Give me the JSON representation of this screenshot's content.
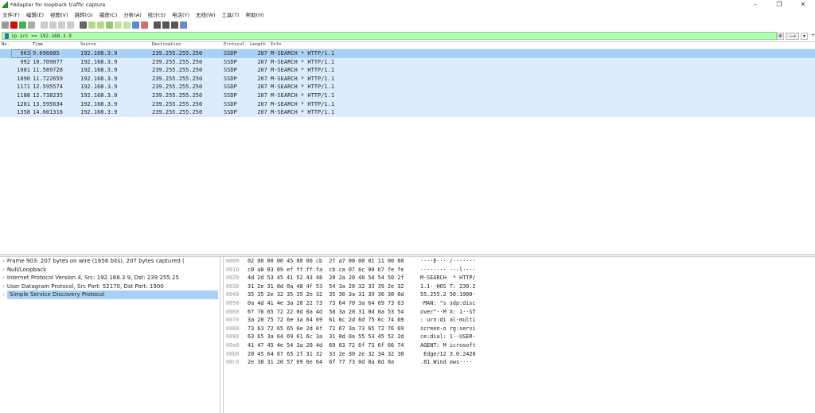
{
  "window": {
    "title": "*Adapter for loopback traffic capture",
    "minimize": "–",
    "maximize": "❐",
    "close": "✕"
  },
  "menu": [
    "文件(F)",
    "编辑(E)",
    "视图(V)",
    "跳转(G)",
    "捕获(C)",
    "分析(A)",
    "统计(S)",
    "电话(Y)",
    "无线(W)",
    "工具(T)",
    "帮助(H)"
  ],
  "toolbar": [
    {
      "icon": "shark-fin-start-icon",
      "color": "#9a9a9a"
    },
    {
      "icon": "stop-icon",
      "color": "#d01010"
    },
    {
      "icon": "restart-icon",
      "color": "#4caf50"
    },
    {
      "icon": "options-gear-icon",
      "color": "#aaaaaa"
    },
    {
      "icon": "open-file-icon",
      "color": "#cccccc"
    },
    {
      "icon": "save-icon",
      "color": "#cccccc"
    },
    {
      "icon": "close-file-icon",
      "color": "#cccccc"
    },
    {
      "icon": "reload-icon",
      "color": "#cccccc"
    },
    {
      "icon": "find-icon",
      "color": "#666666"
    },
    {
      "icon": "back-icon",
      "color": "#b8d88a"
    },
    {
      "icon": "forward-icon",
      "color": "#b8d88a"
    },
    {
      "icon": "go-to-packet-icon",
      "color": "#9bc27a"
    },
    {
      "icon": "first-packet-icon",
      "color": "#c8e0a0"
    },
    {
      "icon": "last-packet-icon",
      "color": "#c8e0a0"
    },
    {
      "icon": "autoscroll-icon",
      "color": "#5a8ad0"
    },
    {
      "icon": "colorize-icon",
      "color": "#d07070"
    },
    {
      "icon": "zoom-in-icon",
      "color": "#555555"
    },
    {
      "icon": "zoom-out-icon",
      "color": "#555555"
    },
    {
      "icon": "zoom-reset-icon",
      "color": "#555555"
    },
    {
      "icon": "resize-columns-icon",
      "color": "#6a8ac8"
    }
  ],
  "filter": {
    "value": "ip.src == 192.168.3.9",
    "clear": "⊗",
    "apply": "⟶",
    "dropdown": "▾",
    "add": "+"
  },
  "columns": {
    "no": "No.",
    "time": "Time",
    "source": "Source",
    "destination": "Destination",
    "protocol": "Protocol",
    "length": "Length",
    "info": "Info"
  },
  "packets": [
    {
      "no": "903",
      "time": "9.696685",
      "source": "192.168.3.9",
      "destination": "239.255.255.250",
      "protocol": "SSDP",
      "length": "207",
      "info": "M-SEARCH * HTTP/1.1"
    },
    {
      "no": "992",
      "time": "10.709077",
      "source": "192.168.3.9",
      "destination": "239.255.255.250",
      "protocol": "SSDP",
      "length": "207",
      "info": "M-SEARCH * HTTP/1.1"
    },
    {
      "no": "1081",
      "time": "11.589728",
      "source": "192.168.3.9",
      "destination": "239.255.255.250",
      "protocol": "SSDP",
      "length": "207",
      "info": "M-SEARCH * HTTP/1.1"
    },
    {
      "no": "1090",
      "time": "11.722659",
      "source": "192.168.3.9",
      "destination": "239.255.255.250",
      "protocol": "SSDP",
      "length": "207",
      "info": "M-SEARCH * HTTP/1.1"
    },
    {
      "no": "1171",
      "time": "12.595574",
      "source": "192.168.3.9",
      "destination": "239.255.255.250",
      "protocol": "SSDP",
      "length": "207",
      "info": "M-SEARCH * HTTP/1.1"
    },
    {
      "no": "1188",
      "time": "12.738235",
      "source": "192.168.3.9",
      "destination": "239.255.255.250",
      "protocol": "SSDP",
      "length": "207",
      "info": "M-SEARCH * HTTP/1.1"
    },
    {
      "no": "1261",
      "time": "13.595634",
      "source": "192.168.3.9",
      "destination": "239.255.255.250",
      "protocol": "SSDP",
      "length": "207",
      "info": "M-SEARCH * HTTP/1.1"
    },
    {
      "no": "1358",
      "time": "14.601316",
      "source": "192.168.3.9",
      "destination": "239.255.255.250",
      "protocol": "SSDP",
      "length": "207",
      "info": "M-SEARCH * HTTP/1.1"
    }
  ],
  "details": [
    {
      "text": "Frame 903: 207 bytes on wire (1656 bits), 207 bytes captured (",
      "expanded": false
    },
    {
      "text": "Null/Loopback",
      "expanded": false
    },
    {
      "text": "Internet Protocol Version 4, Src: 192.168.3.9, Dst: 239.255.25",
      "expanded": false
    },
    {
      "text": "User Datagram Protocol, Src Port: 52170, Dst Port: 1900",
      "expanded": false
    },
    {
      "text": "Simple Service Discovery Protocol",
      "expanded": false,
      "selected": true
    }
  ],
  "hex": [
    {
      "off": "0000",
      "bytes": "02 00 00 00 45 00 00 cb  2f a7 00 00 01 11 00 00",
      "ascii": "····E··· /·······"
    },
    {
      "off": "0010",
      "bytes": "c0 a8 03 09 ef ff ff fa  cb ca 07 6c 00 b7 fe fe",
      "ascii": "········ ···l····"
    },
    {
      "off": "0020",
      "bytes": "4d 2d 53 45 41 52 43 48  20 2a 20 48 54 54 50 2f",
      "ascii": "M-SEARCH  * HTTP/"
    },
    {
      "off": "0030",
      "bytes": "31 2e 31 0d 0a 48 4f 53  54 3a 20 32 33 39 2e 32",
      "ascii": "1.1··HOS T: 239.2"
    },
    {
      "off": "0040",
      "bytes": "35 35 2e 32 35 35 2e 32  35 30 3a 31 39 30 30 0d",
      "ascii": "55.255.2 50:1900·"
    },
    {
      "off": "0050",
      "bytes": "0a 4d 41 4e 3a 20 22 73  73 64 70 3a 64 69 73 63",
      "ascii": "·MAN: \"s sdp:disc"
    },
    {
      "off": "0060",
      "bytes": "6f 76 65 72 22 0d 0a 4d  58 3a 20 31 0d 0a 53 54",
      "ascii": "over\"··M X: 1··ST"
    },
    {
      "off": "0070",
      "bytes": "3a 20 75 72 6e 3a 64 69  61 6c 2d 6d 75 6c 74 69",
      "ascii": ": urn:di al-multi"
    },
    {
      "off": "0080",
      "bytes": "73 63 72 65 65 6e 2d 6f  72 67 3a 73 65 72 76 69",
      "ascii": "screen-o rg:servi"
    },
    {
      "off": "0090",
      "bytes": "63 65 3a 64 69 61 6c 3a  31 0d 0a 55 53 45 52 2d",
      "ascii": "ce:dial: 1··USER-"
    },
    {
      "off": "00a0",
      "bytes": "41 47 45 4e 54 3a 20 4d  69 63 72 6f 73 6f 66 74",
      "ascii": "AGENT: M icrosoft"
    },
    {
      "off": "00b0",
      "bytes": "20 45 64 67 65 2f 31 32  33 2e 30 2e 32 34 32 30",
      "ascii": " Edge/12 3.0.2420"
    },
    {
      "off": "00c0",
      "bytes": "2e 38 31 20 57 69 6e 64  6f 77 73 0d 0a 0d 0a",
      "ascii": ".81 Wind ows····"
    }
  ],
  "colors": {
    "row_bg": "#dcecfc",
    "row_selected": "#a9d0f5",
    "filter_valid": "#afffaf"
  }
}
